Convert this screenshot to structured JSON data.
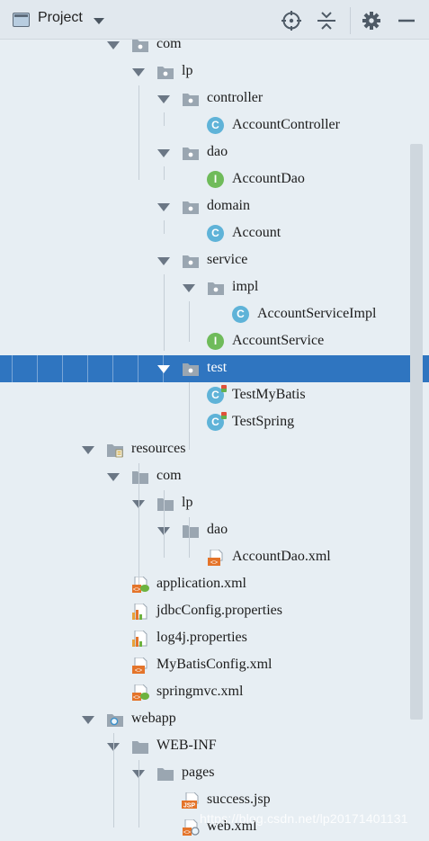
{
  "header": {
    "title": "Project",
    "tools": [
      "crosshair-icon",
      "collapse-all-icon",
      "gear-icon",
      "minimize-icon"
    ]
  },
  "tree": [
    {
      "label": "com",
      "icon": "package-folder",
      "expanded": true
    },
    {
      "label": "lp",
      "icon": "package-folder",
      "expanded": true
    },
    {
      "label": "controller",
      "icon": "package-folder",
      "expanded": true
    },
    {
      "label": "AccountController",
      "icon": "class-c"
    },
    {
      "label": "dao",
      "icon": "package-folder",
      "expanded": true
    },
    {
      "label": "AccountDao",
      "icon": "interface-i"
    },
    {
      "label": "domain",
      "icon": "package-folder",
      "expanded": true
    },
    {
      "label": "Account",
      "icon": "class-c"
    },
    {
      "label": "service",
      "icon": "package-folder",
      "expanded": true
    },
    {
      "label": "impl",
      "icon": "package-folder",
      "expanded": true
    },
    {
      "label": "AccountServiceImpl",
      "icon": "class-c"
    },
    {
      "label": "AccountService",
      "icon": "interface-i"
    },
    {
      "label": "test",
      "icon": "package-folder",
      "expanded": true,
      "selected": true
    },
    {
      "label": "TestMyBatis",
      "icon": "test-class-c"
    },
    {
      "label": "TestSpring",
      "icon": "test-class-c"
    },
    {
      "label": "resources",
      "icon": "resources-folder",
      "expanded": true
    },
    {
      "label": "com",
      "icon": "plain-folder",
      "expanded": true
    },
    {
      "label": "lp",
      "icon": "plain-folder",
      "expanded": true
    },
    {
      "label": "dao",
      "icon": "plain-folder",
      "expanded": true
    },
    {
      "label": "AccountDao.xml",
      "icon": "xml-file"
    },
    {
      "label": "application.xml",
      "icon": "spring-xml-file"
    },
    {
      "label": "jdbcConfig.properties",
      "icon": "properties-file"
    },
    {
      "label": "log4j.properties",
      "icon": "properties-file"
    },
    {
      "label": "MyBatisConfig.xml",
      "icon": "xml-file"
    },
    {
      "label": "springmvc.xml",
      "icon": "spring-xml-file"
    },
    {
      "label": "webapp",
      "icon": "web-folder",
      "expanded": true
    },
    {
      "label": "WEB-INF",
      "icon": "plain-folder",
      "expanded": true
    },
    {
      "label": "pages",
      "icon": "plain-folder",
      "expanded": true
    },
    {
      "label": "success.jsp",
      "icon": "jsp-file"
    },
    {
      "label": "web.xml",
      "icon": "web-xml-file"
    }
  ],
  "watermark": "https://blog.csdn.net/lp20171401131",
  "colors": {
    "selection": "#2f75c0",
    "background": "#e7eef3",
    "class_badge": "#5fb3d8",
    "interface_badge": "#6fbb5a"
  }
}
